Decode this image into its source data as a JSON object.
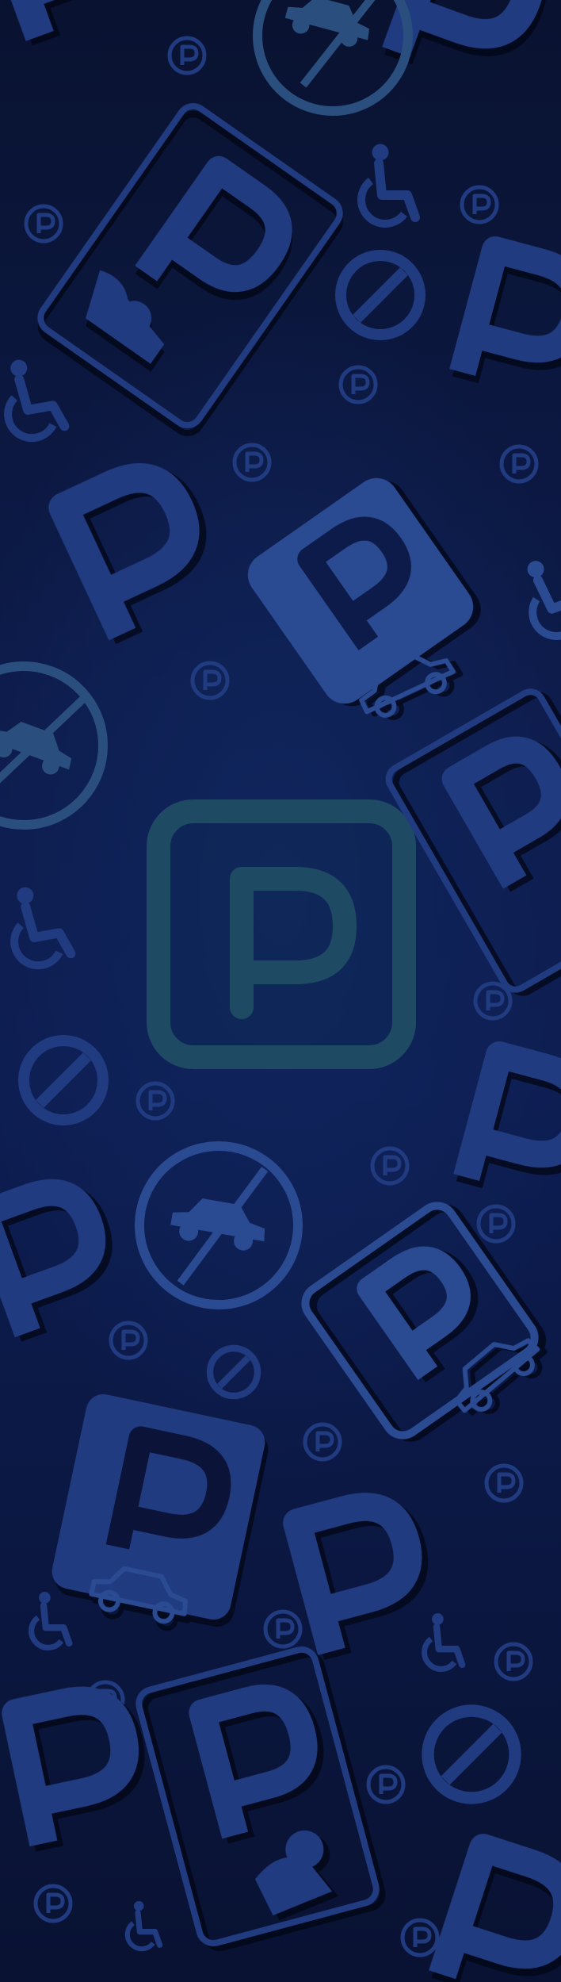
{
  "background": {
    "base_color": "#0b1438",
    "gradient_colors": [
      "#091230",
      "#0d1b4a",
      "#0d1d52",
      "#091232"
    ]
  },
  "center_emblem": {
    "icon": "parking-sign-icon",
    "letter": "P",
    "color": "#1f4a63"
  },
  "pattern": {
    "primary_color": "#213b80",
    "secondary_color": "#2a4a92",
    "teal_color": "#2a4f7e",
    "small_badge_letter": "P",
    "icons": [
      "letter-p-icon",
      "parking-coin-icon",
      "no-car-icon",
      "wheelchair-icon",
      "no-entry-icon",
      "parking-meter-card-icon",
      "parking-car-square-icon",
      "parking-car-diamond-icon"
    ]
  }
}
